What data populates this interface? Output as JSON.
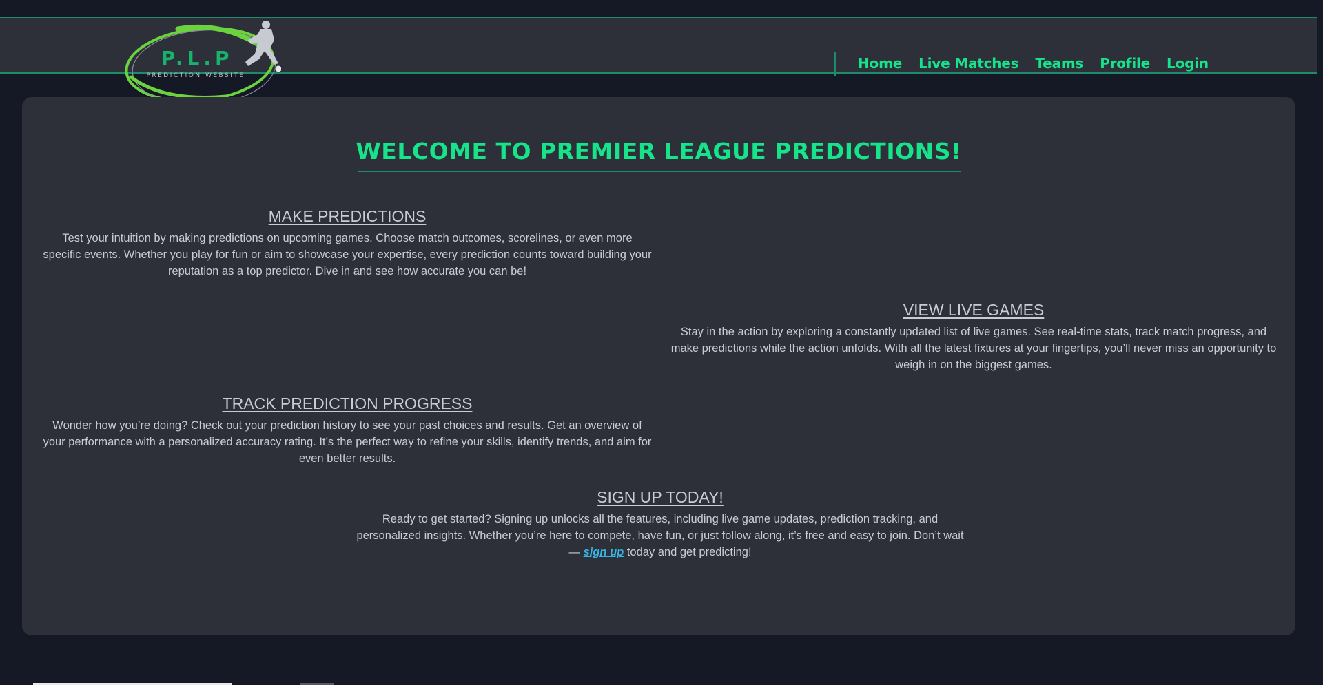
{
  "header": {
    "logo": {
      "title": "P.L.P",
      "subtitle": "PREDICTION WEBSITE",
      "icon": "soccer-player-icon"
    },
    "nav": [
      {
        "label": "Home"
      },
      {
        "label": "Live Matches"
      },
      {
        "label": "Teams"
      },
      {
        "label": "Profile"
      },
      {
        "label": "Login"
      }
    ]
  },
  "main": {
    "welcome_title": "WELCOME TO PREMIER LEAGUE PREDICTIONS!",
    "sections": [
      {
        "heading": "MAKE PREDICTIONS",
        "body": "Test your intuition by making predictions on upcoming games. Choose match outcomes, scorelines, or even more specific events. Whether you play for fun or aim to showcase your expertise, every prediction counts toward building your reputation as a top predictor. Dive in and see how accurate you can be!"
      },
      {
        "heading": "VIEW LIVE GAMES",
        "body": "Stay in the action by exploring a constantly updated list of live games. See real-time stats, track match progress, and make predictions while the action unfolds. With all the latest fixtures at your fingertips, you’ll never miss an opportunity to weigh in on the biggest games."
      },
      {
        "heading": "TRACK PREDICTION PROGRESS",
        "body": "Wonder how you’re doing? Check out your prediction history to see your past choices and results. Get an overview of your performance with a personalized accuracy rating. It’s the perfect way to refine your skills, identify trends, and aim for even better results."
      },
      {
        "heading": "SIGN UP TODAY!",
        "body_before": "Ready to get started? Signing up unlocks all the features, including live game updates, prediction tracking, and personalized insights. Whether you’re here to compete, have fun, or just follow along, it’s free and easy to join. Don’t wait — ",
        "link_label": "sign up",
        "body_after": " today and get predicting!"
      }
    ]
  },
  "colors": {
    "page_background": "#151825",
    "card_background": "#2d3039",
    "accent_green": "#17e38a",
    "border_green": "#1d8c6a",
    "link_blue": "#35b6e5",
    "body_text": "#c9ccd2"
  }
}
